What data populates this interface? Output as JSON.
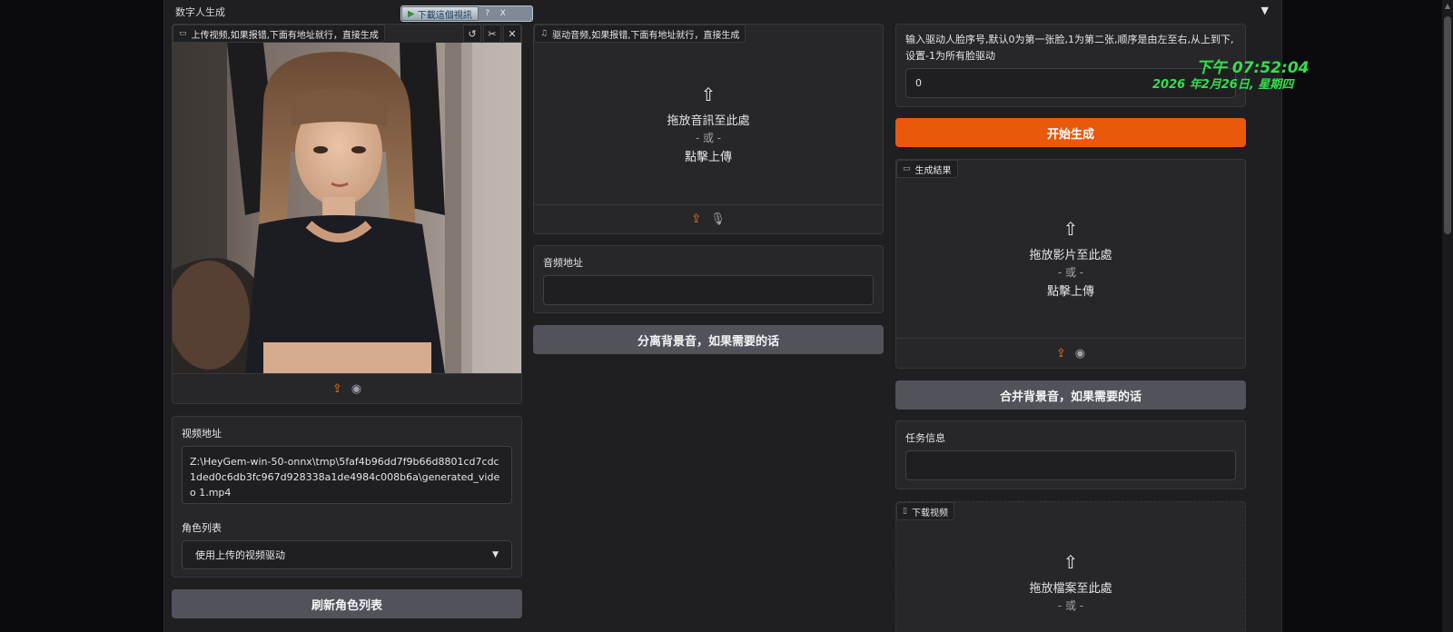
{
  "app": {
    "title": "数字人生成",
    "collapse_icon": "triangle-down-icon",
    "downloader": {
      "label": "下載這個視訊",
      "help": "?",
      "close": "X"
    }
  },
  "left": {
    "video_tag": "上传视频,如果报错,下面有地址就行，直接生成",
    "video_path_label": "视频地址",
    "video_path_value": "Z:\\HeyGem-win-50-onnx\\tmp\\5faf4b96dd7f9b66d8801cd7cdc1ded0c6db3fc967d928338a1de4984c008b6a\\generated_video 1.mp4",
    "role_list_label": "角色列表",
    "role_list_selected": "使用上传的视频驱动",
    "refresh_button": "刷新角色列表"
  },
  "middle": {
    "audio_tag": "驱动音频,如果报错,下面有地址就行，直接生成",
    "drop_line1": "拖放音訊至此處",
    "drop_line2": "- 或 -",
    "drop_line3": "點擊上傳",
    "audio_path_label": "音频地址",
    "audio_path_value": "",
    "separate_button": "分离背景音，如果需要的话"
  },
  "right": {
    "face_label": "输入驱动人脸序号,默认0为第一张脸,1为第二张,顺序是由左至右,从上到下,设置-1为所有脸驱动",
    "face_value": "0",
    "start_button": "开始生成",
    "result_tag": "生成結果",
    "result_drop1": "拖放影片至此處",
    "result_drop2": "- 或 -",
    "result_drop3": "點擊上傳",
    "merge_button": "合并背景音，如果需要的话",
    "task_label": "任务信息",
    "task_value": "",
    "download_tag": "下载视频",
    "download_drop1": "拖放檔案至此處",
    "download_drop2": "- 或 -"
  },
  "overlay_clock": {
    "time": "下午 07:52:04",
    "date": "2026 年2月26日, 星期四",
    "color": "#32e04a"
  },
  "colors": {
    "accent": "#ea580c",
    "panel": "#27272a",
    "background": "#1f1f22"
  }
}
